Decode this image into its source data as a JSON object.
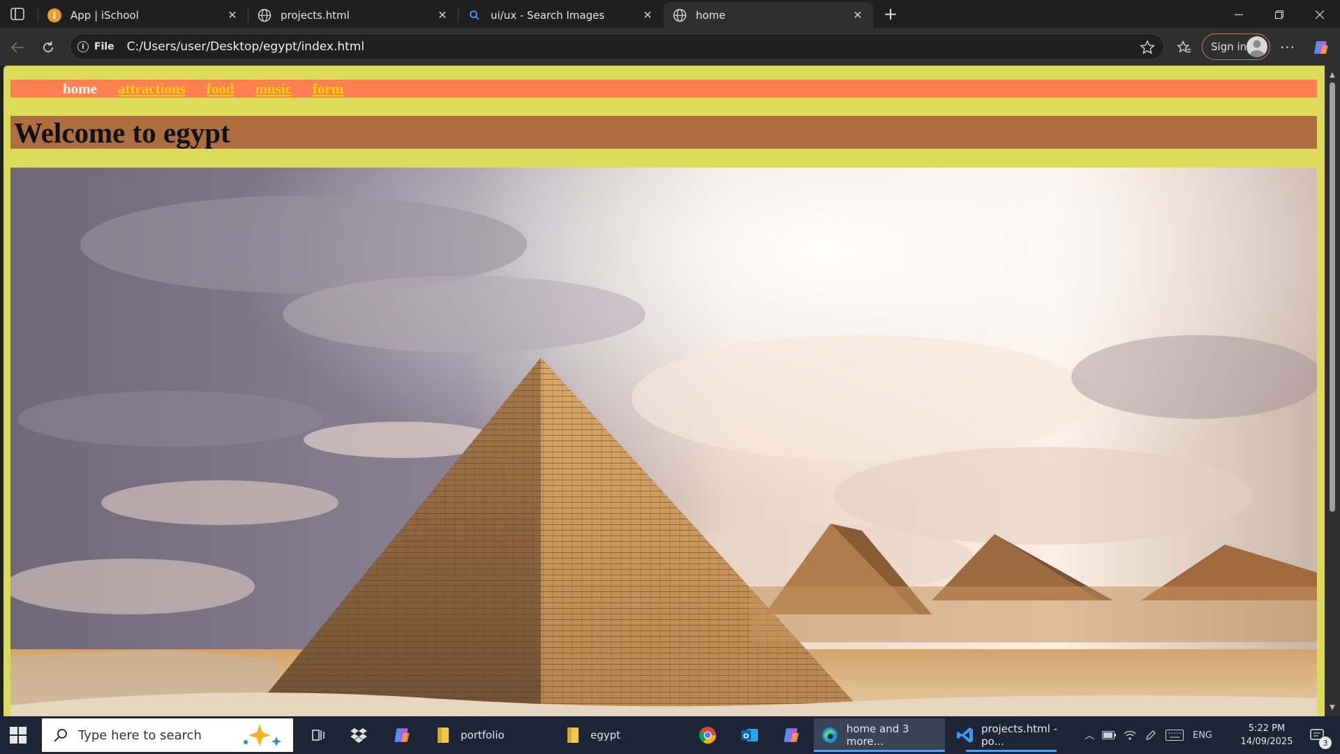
{
  "browser": {
    "tabs": [
      {
        "title": "App | iSchool",
        "icon": "ischool-logo-icon"
      },
      {
        "title": "projects.html",
        "icon": "globe-icon"
      },
      {
        "title": "ui/ux - Search Images",
        "icon": "search-icon"
      },
      {
        "title": "home",
        "icon": "globe-icon",
        "active": true
      }
    ],
    "address": {
      "scheme_label": "File",
      "url": "C:/Users/user/Desktop/egypt/index.html"
    },
    "signin_label": "Sign in"
  },
  "page": {
    "nav": [
      {
        "label": "home",
        "current": true
      },
      {
        "label": "attractions"
      },
      {
        "label": "food"
      },
      {
        "label": "music"
      },
      {
        "label": "form"
      }
    ],
    "heading": "Welcome to egypt",
    "colors": {
      "page_bg": "#dcdc5a",
      "nav_bg": "#ff7f50",
      "nav_link": "#ffd700",
      "heading_bg": "#ad6f40"
    },
    "hero_image": "pyramids of giza photo"
  },
  "taskbar": {
    "search_placeholder": "Type here to search",
    "items": [
      {
        "label": "portfolio",
        "icon": "folder-icon"
      },
      {
        "label": "egypt",
        "icon": "folder-icon"
      },
      {
        "label": "home and 3 more...",
        "icon": "edge-icon"
      },
      {
        "label": "projects.html - po...",
        "icon": "vscode-icon"
      }
    ],
    "language": "ENG",
    "time": "5:22 PM",
    "date": "14/09/2025",
    "notification_count": "3"
  }
}
